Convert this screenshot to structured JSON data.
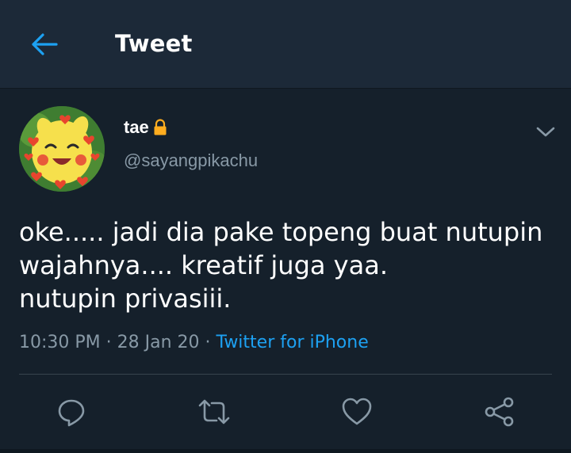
{
  "header": {
    "title": "Tweet",
    "back_icon": "arrow-left-icon",
    "accent_color": "#1da1f2",
    "background_color": "#1c2938"
  },
  "tweet": {
    "author": {
      "display_name": "tae",
      "handle": "@sayangpikachu",
      "protected_icon": "lock-icon",
      "avatar": "pikachu-with-hearts-avatar"
    },
    "text_lines": [
      "oke..... jadi dia pake topeng buat nutupin",
      "wajahnya.... kreatif juga yaa.",
      "nutupin privasiii."
    ],
    "time": "10:30 PM",
    "separator1": " · ",
    "date": "28 Jan 20",
    "separator2": " · ",
    "source": "Twitter for iPhone",
    "menu_icon": "chevron-down-icon"
  },
  "actions": [
    {
      "name": "reply",
      "icon": "reply-icon"
    },
    {
      "name": "retweet",
      "icon": "retweet-icon"
    },
    {
      "name": "like",
      "icon": "heart-icon"
    },
    {
      "name": "share",
      "icon": "share-icon"
    }
  ],
  "colors": {
    "background": "#15202b",
    "secondary_text": "#8899a6",
    "link": "#1da1f2",
    "divider": "#38444d",
    "lock": "#ffad1f"
  }
}
